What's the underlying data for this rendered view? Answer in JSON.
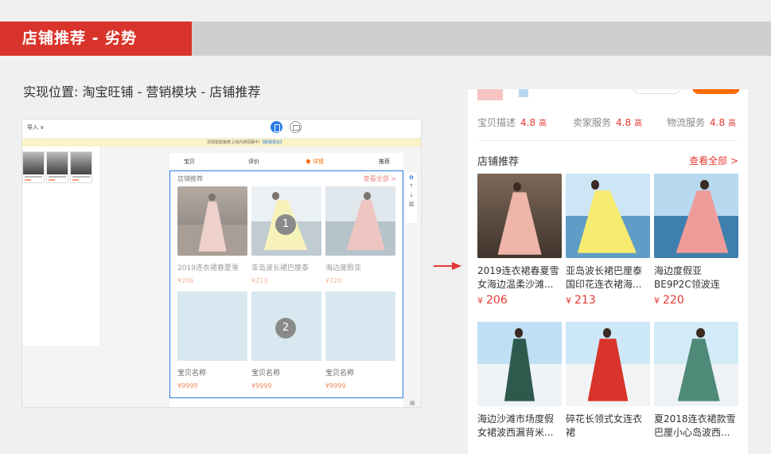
{
  "banner": {
    "title": "店铺推荐 - 劣势"
  },
  "subtitle": "实现位置: 淘宝旺铺 - 营销模块 - 店铺推荐",
  "editor": {
    "import_label": "导入 ∨",
    "notice": "详情智能装修上线内测招募中!",
    "notice_link": "【戳我报名】",
    "tabs": [
      "宝贝",
      "评价",
      "详情",
      "推荐"
    ],
    "module_title": "店铺推荐",
    "module_more": "查看全部 >",
    "products": [
      {
        "title": "2019连衣裙春夏雪",
        "price": "¥206"
      },
      {
        "title": "亚岛波长裙巴厘泰",
        "price": "¥213"
      },
      {
        "title": "海边度假亚",
        "price": "¥220"
      }
    ],
    "placeholders": [
      {
        "title": "宝贝名称",
        "price": "¥9999"
      },
      {
        "title": "宝贝名称",
        "price": "¥9999"
      },
      {
        "title": "宝贝名称",
        "price": "¥9999"
      }
    ],
    "badge_1": "1",
    "badge_2": "2"
  },
  "mobile": {
    "ratings": [
      {
        "label": "宝贝描述",
        "value": "4.8",
        "grade": "高"
      },
      {
        "label": "卖家服务",
        "value": "4.8",
        "grade": "高"
      },
      {
        "label": "物流服务",
        "value": "4.8",
        "grade": "高"
      }
    ],
    "section_title": "店铺推荐",
    "section_more": "查看全部 >",
    "products": [
      {
        "title": "2019连衣裙春夏雪女海边温柔沙滩...",
        "currency": "¥",
        "price": "206"
      },
      {
        "title": "亚岛波长裙巴厘泰国印花连衣裙海...",
        "currency": "¥",
        "price": "213"
      },
      {
        "title": "海边度假亚BE9P2C领波连衣...",
        "currency": "¥",
        "price": "220"
      },
      {
        "title": "海边沙滩市场度假女裙波西漏背米...",
        "currency": "",
        "price": ""
      },
      {
        "title": "碎花长领式女连衣裙",
        "currency": "",
        "price": ""
      },
      {
        "title": "夏2018连衣裙款雪巴厘小心岛波西...",
        "currency": "",
        "price": ""
      }
    ]
  },
  "colors": {
    "brand_red": "#d9342b",
    "accent_orange": "#ff6a00",
    "price_red": "#e53935",
    "editor_blue": "#2c7be5"
  }
}
